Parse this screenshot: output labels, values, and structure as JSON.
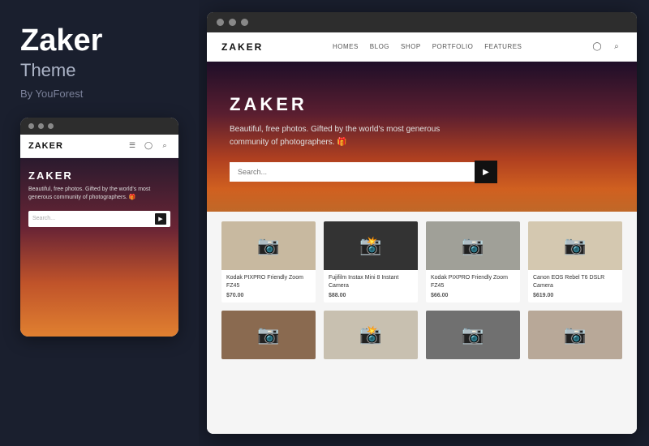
{
  "left": {
    "title": "Zaker",
    "subtitle": "Theme",
    "author": "By YouForest",
    "mobile": {
      "logo": "ZAKER",
      "hero_title": "ZAKER",
      "hero_text": "Beautiful, free photos. Gifted by the world's most generous community of photographers. 🎁",
      "search_placeholder": "Search...",
      "search_btn": "🔍"
    }
  },
  "right": {
    "desktop": {
      "logo": "ZAKER",
      "nav": [
        "HOMES",
        "BLOG",
        "SHOP",
        "PORTFOLIO",
        "FEATURES"
      ],
      "hero_title": "ZAKER",
      "hero_subtitle": "Beautiful, free photos. Gifted by the world's most generous community of photographers. 🎁",
      "search_placeholder": "Search...",
      "products": [
        {
          "name": "Kodak PIXPRO Friendly Zoom FZ45",
          "price": "$70.00",
          "bg": "#c8b9a0",
          "emoji": "📷"
        },
        {
          "name": "Fujifilm Instax Mini 8 Instant Camera",
          "price": "$88.00",
          "bg": "#333333",
          "emoji": "📸"
        },
        {
          "name": "Kodak PIXPRO Friendly Zoom FZ45",
          "price": "$66.00",
          "bg": "#a0a098",
          "emoji": "📷"
        },
        {
          "name": "Canon EOS Rebel T6 DSLR Camera",
          "price": "$619.00",
          "bg": "#d4c8b0",
          "emoji": "📷"
        }
      ],
      "products_row2": [
        {
          "name": "",
          "price": "",
          "bg": "#8a6a50",
          "emoji": "📷"
        },
        {
          "name": "",
          "price": "",
          "bg": "#c8c0b0",
          "emoji": "📸"
        },
        {
          "name": "",
          "price": "",
          "bg": "#707070",
          "emoji": "📷"
        },
        {
          "name": "",
          "price": "",
          "bg": "#b8a898",
          "emoji": "📷"
        }
      ]
    }
  }
}
